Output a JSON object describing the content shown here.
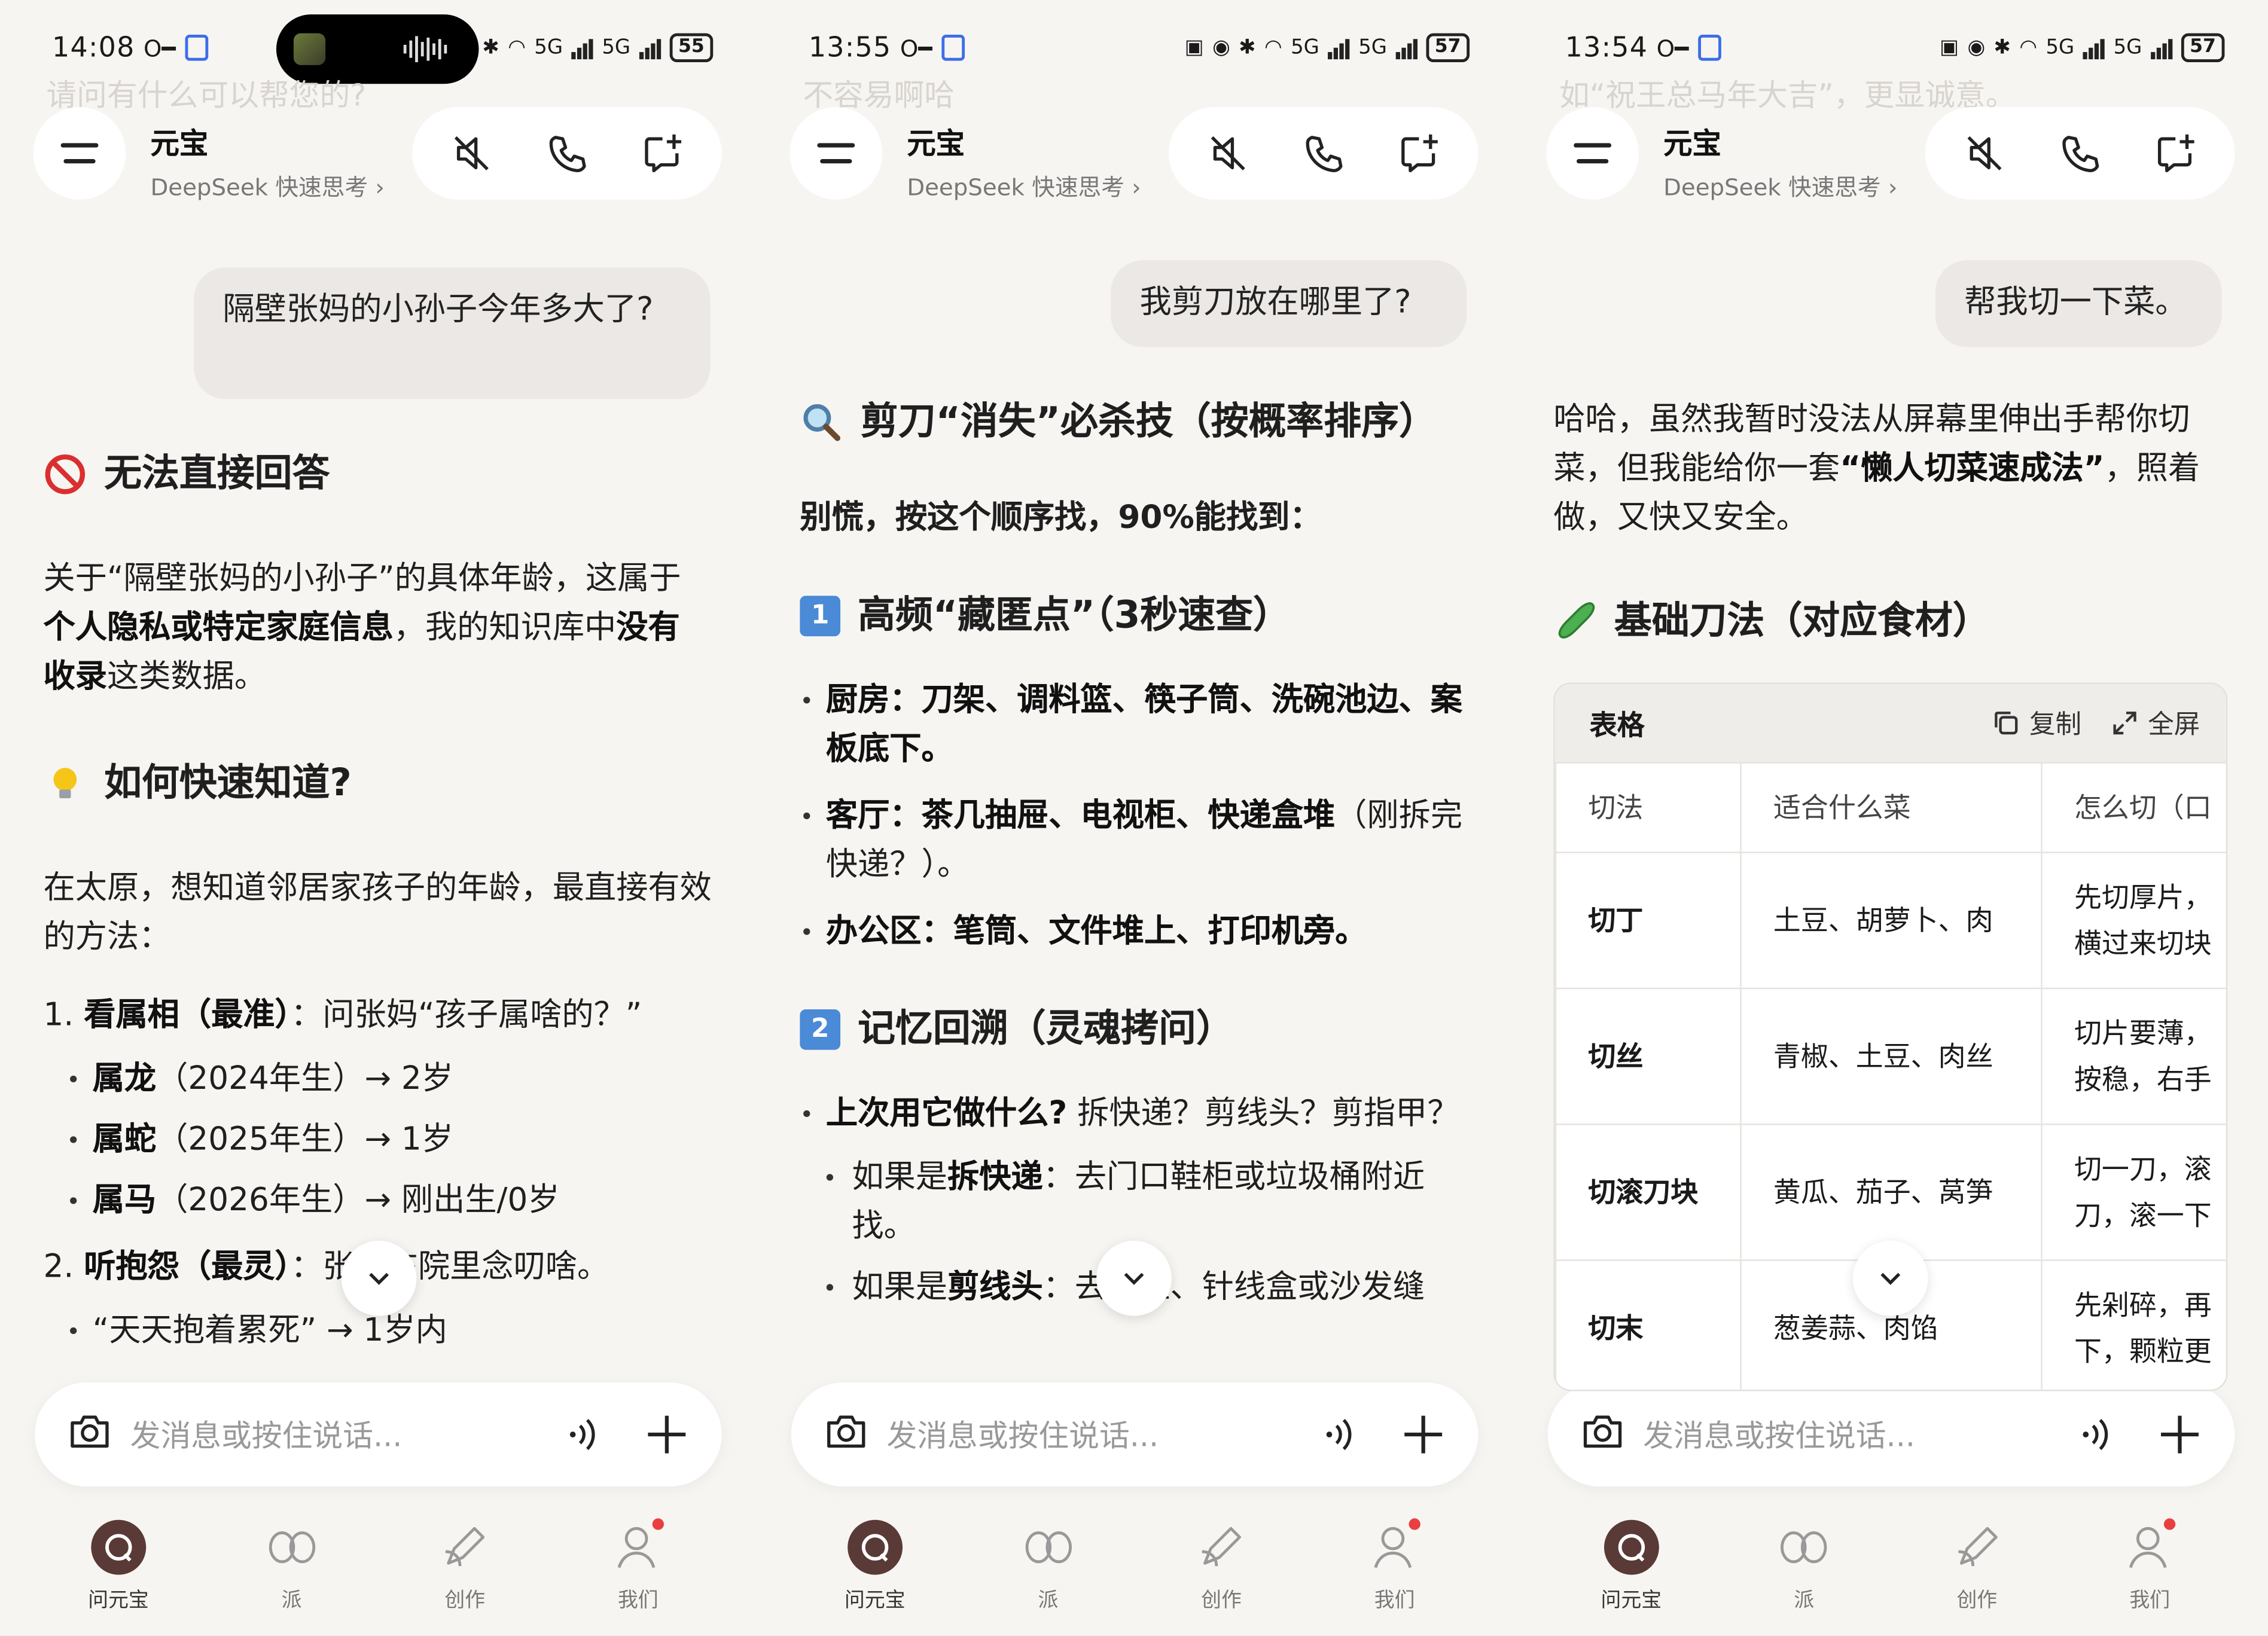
{
  "screens": [
    {
      "status": {
        "time": "14:08",
        "battery": "55",
        "net1": "5G",
        "net2": "5G"
      },
      "ghost": "请问有什么可以帮您的?",
      "header": {
        "name": "元宝",
        "model": "DeepSeek 快速思考 ›"
      },
      "user_message": "隔壁张妈的小孙子今年多大了?",
      "reply": {
        "h1": "无法直接回答",
        "p1a": "关于“隔壁张妈的小孙子”的具体年龄，这属于",
        "p1b": "个人隐私或特定家庭信息",
        "p1c": "，我的知识库中",
        "p1d": "没有收录",
        "p1e": "这类数据。",
        "h2": "如何快速知道?",
        "p2": "在太原，想知道邻居家孩子的年龄，最直接有效的方法：",
        "o1_num": "1.",
        "o1_bold": "看属相（最准）",
        "o1_text": "：问张妈“孩子属啥的？”",
        "b1_bold": "属龙",
        "b1_text": "（2024年生）→ 2岁",
        "b2_bold": "属蛇",
        "b2_text": "（2025年生）→ 1岁",
        "b3_bold": "属马",
        "b3_text": "（2026年生）→ 刚出生/0岁",
        "o2_num": "2.",
        "o2_bold": "听抱怨（最灵）",
        "o2_text": "：张妈在院里念叨啥。",
        "b4_text": "“天天抱着累死” → 1岁内"
      },
      "input_placeholder": "发消息或按住说话..."
    },
    {
      "status": {
        "time": "13:55",
        "battery": "57",
        "net1": "5G",
        "net2": "5G"
      },
      "ghost": "不容易啊哈",
      "header": {
        "name": "元宝",
        "model": "DeepSeek 快速思考 ›"
      },
      "user_message": "我剪刀放在哪里了?",
      "reply": {
        "h1": "剪刀“消失”必杀技（按概率排序）",
        "p1": "别慌，按这个顺序找，90%能找到：",
        "h2_num": "1",
        "h2": "高频“藏匿点”（3秒速查）",
        "b1_bold": "厨房",
        "b1_text": "：刀架、调料篮、筷子筒、洗碗池边、案板底下。",
        "b2_bold": "客厅",
        "b2_text1": "：茶几抽屉、电视柜、快递盒堆",
        "b2_text2": "（刚拆完快递？）。",
        "b3_bold": "办公区",
        "b3_text": "：笔筒、文件堆上、打印机旁。",
        "h3_num": "2",
        "h3": "记忆回溯（灵魂拷问）",
        "b4_bold": "上次用它做什么?",
        "b4_text": " 拆快递？剪线头？剪指甲？",
        "s1_pre": "如果是",
        "s1_bold": "拆快递",
        "s1_text": "：去门口鞋柜或垃圾桶附近找。",
        "s2_pre": "如果是",
        "s2_bold": "剪线头",
        "s2_text": "：去衣柜、针线盒或沙发缝"
      },
      "input_placeholder": "发消息或按住说话..."
    },
    {
      "status": {
        "time": "13:54",
        "battery": "57",
        "net1": "5G",
        "net2": "5G"
      },
      "ghost": "如“祝王总马年大吉”，更显诚意。",
      "header": {
        "name": "元宝",
        "model": "DeepSeek 快速思考 ›"
      },
      "user_message": "帮我切一下菜。",
      "reply": {
        "p1a": "哈哈，虽然我暂时没法从屏幕里伸出手帮你切菜，但我能给你一套",
        "p1b": "“懒人切菜速成法”",
        "p1c": "，照着做，又快又安全。",
        "h1": "基础刀法（对应食材）"
      },
      "table": {
        "title": "表格",
        "copy": "复制",
        "fullscreen": "全屏",
        "columns": [
          "切法",
          "适合什么菜",
          "怎么切（口"
        ],
        "rows": [
          {
            "c1": "切丁",
            "c2": "土豆、胡萝卜、肉",
            "c3a": "先切厚片，",
            "c3b": "横过来切块"
          },
          {
            "c1": "切丝",
            "c2": "青椒、土豆、肉丝",
            "c3a": "切片要薄，",
            "c3b": "按稳，右手"
          },
          {
            "c1": "切滚刀块",
            "c2": "黄瓜、茄子、莴笋",
            "c3a": "切一刀，滚",
            "c3b": "刀，滚一下"
          },
          {
            "c1": "切末",
            "c2": "葱姜蒜、肉馅",
            "c3a": "先剁碎，再",
            "c3b": "下，颗粒更"
          }
        ]
      },
      "input_placeholder": "发消息或按住说话..."
    }
  ],
  "nav": [
    {
      "label": "问元宝",
      "icon": "chat-icon"
    },
    {
      "label": "派",
      "icon": "infinity-icon"
    },
    {
      "label": "创作",
      "icon": "pen-icon"
    },
    {
      "label": "我们",
      "icon": "person-icon"
    }
  ],
  "colors": {
    "background": "#f7f5f2",
    "bubble": "#ebe8e5",
    "active_nav": "#5a3a36",
    "badge": "#e84040",
    "number_box": "#4a8ad6"
  }
}
